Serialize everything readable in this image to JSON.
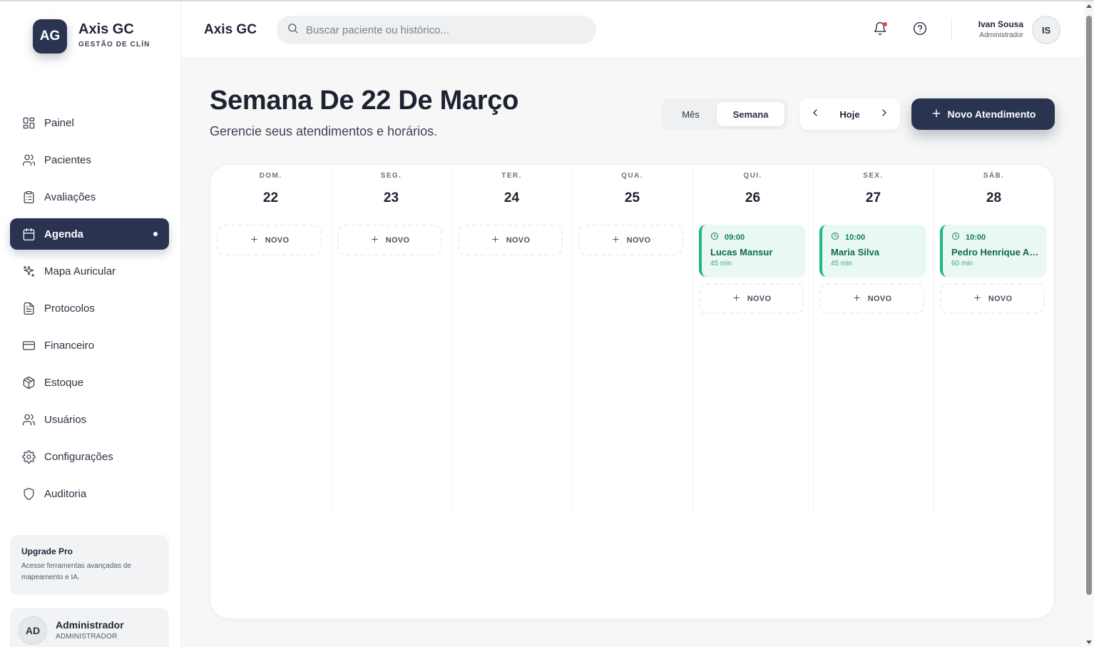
{
  "brand": {
    "initials": "AG",
    "name": "Axis GC",
    "subtitle": "GESTÃO DE CLÍN"
  },
  "sidebar": {
    "items": [
      {
        "label": "Painel",
        "icon": "layout-grid-icon",
        "active": false
      },
      {
        "label": "Pacientes",
        "icon": "users-icon",
        "active": false
      },
      {
        "label": "Avaliações",
        "icon": "clipboard-icon",
        "active": false
      },
      {
        "label": "Agenda",
        "icon": "calendar-icon",
        "active": true
      },
      {
        "label": "Mapa Auricular",
        "icon": "sparkles-icon",
        "active": false
      },
      {
        "label": "Protocolos",
        "icon": "file-text-icon",
        "active": false
      },
      {
        "label": "Financeiro",
        "icon": "credit-card-icon",
        "active": false
      },
      {
        "label": "Estoque",
        "icon": "package-icon",
        "active": false
      },
      {
        "label": "Usuários",
        "icon": "users-icon",
        "active": false
      },
      {
        "label": "Configurações",
        "icon": "gear-icon",
        "active": false
      },
      {
        "label": "Auditoria",
        "icon": "shield-icon",
        "active": false
      }
    ],
    "upgrade": {
      "title": "Upgrade Pro",
      "text": "Acesse ferramentas avançadas de mapeamento e IA."
    },
    "user": {
      "initials": "AD",
      "name": "Administrador",
      "role": "ADMINISTRADOR"
    }
  },
  "header": {
    "title": "Axis GC",
    "search_placeholder": "Buscar paciente ou histórico...",
    "user": {
      "name": "Ivan Sousa",
      "role": "Administrador",
      "initials": "IS"
    }
  },
  "main": {
    "title": "Semana De 22 De Março",
    "subtitle": "Gerencie seus atendimentos e horários.",
    "view_month": "Mês",
    "view_week": "Semana",
    "today": "Hoje",
    "new_button": "Novo Atendimento"
  },
  "calendar": {
    "new_label": "NOVO",
    "days": [
      {
        "name": "DOM.",
        "number": "22",
        "appointments": []
      },
      {
        "name": "SEG.",
        "number": "23",
        "appointments": []
      },
      {
        "name": "TER.",
        "number": "24",
        "appointments": []
      },
      {
        "name": "QUA.",
        "number": "25",
        "appointments": []
      },
      {
        "name": "QUI.",
        "number": "26",
        "appointments": [
          {
            "time": "09:00",
            "patient": "Lucas Mansur",
            "duration": "45 min"
          }
        ]
      },
      {
        "name": "SEX.",
        "number": "27",
        "appointments": [
          {
            "time": "10:00",
            "patient": "Maria Silva",
            "duration": "45 min"
          }
        ]
      },
      {
        "name": "SÁB.",
        "number": "28",
        "appointments": [
          {
            "time": "10:00",
            "patient": "Pedro Henrique Alves",
            "duration": "60 min"
          }
        ]
      }
    ]
  },
  "colors": {
    "primary": "#2a3350",
    "appointment_bg": "#e9f8f1",
    "appointment_accent": "#1fb783",
    "notification": "#e0484f"
  }
}
